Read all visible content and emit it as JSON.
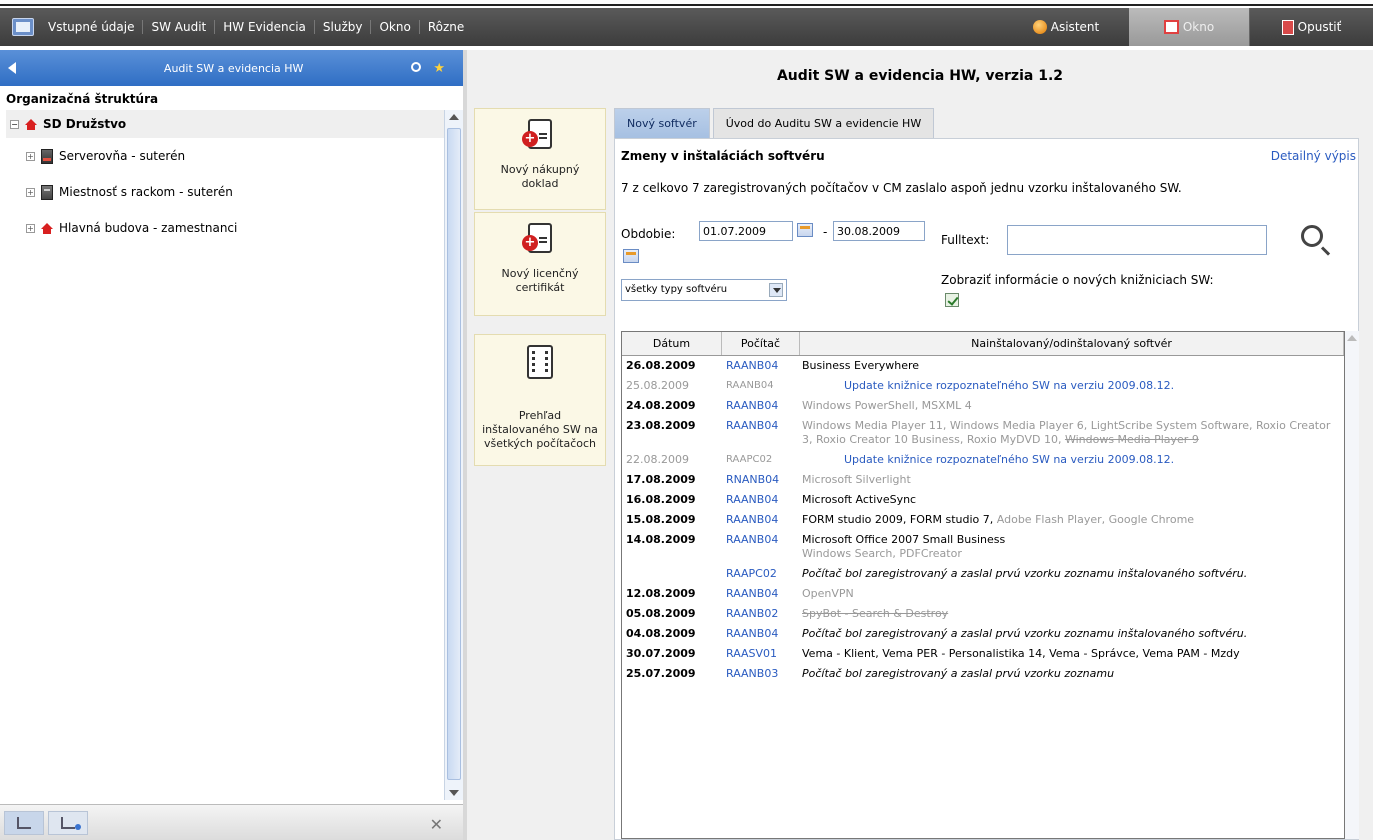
{
  "menubar": {
    "items": [
      "Vstupné údaje",
      "SW Audit",
      "HW Evidencia",
      "Služby",
      "Okno",
      "Rôzne"
    ],
    "asistent": "Asistent",
    "okno": "Okno",
    "opustit": "Opustiť"
  },
  "left": {
    "header": "Audit SW a evidencia HW",
    "org_title": "Organizačná štruktúra",
    "root": "SD Družstvo",
    "items": [
      "Serverovňa - suterén",
      "Miestnosť s rackom - suterén",
      "Hlavná budova - zamestnanci"
    ]
  },
  "main": {
    "app_title": "Audit SW a evidencia HW, verzia 1.2",
    "actions": [
      "Nový nákupný doklad",
      "Nový licenčný certifikát",
      "Prehľad inštalovaného SW na všetkých počítačoch"
    ],
    "tabs": [
      "Nový softvér",
      "Úvod do Auditu SW a evidencie HW"
    ],
    "panel_title": "Zmeny v inštaláciách softvéru",
    "detail_link": "Detailný výpis",
    "summary": "7 z celkovo 7 zaregistrovaných počítačov v CM zaslalo aspoň jednu vzorku inštalovaného SW.",
    "obdobie_label": "Obdobie:",
    "date_from": "01.07.2009",
    "date_to": "30.08.2009",
    "dash": "-",
    "fulltext_label": "Fulltext:",
    "fulltext_value": "",
    "type_select": "všetky typy softvéru",
    "lib_label": "Zobraziť informácie o nových knižniciach SW:",
    "lib_checked": true
  },
  "table": {
    "headers": [
      "Dátum",
      "Počítač",
      "Nainštalovaný/odinštalovaný softvér"
    ],
    "rows": [
      {
        "date": "26.08.2009",
        "pc": "RAANB04",
        "sw": "Business Everywhere"
      },
      {
        "date": "25.08.2009",
        "pc": "RAANB04",
        "sw": "Update knižnice rozpoznateľného SW na verziu 2009.08.12."
      },
      {
        "date": "24.08.2009",
        "pc": "RAANB04",
        "sw": "Windows PowerShell, MSXML 4"
      },
      {
        "date": "23.08.2009",
        "pc": "RAANB04",
        "sw": "Windows Media Player 11, Windows Media Player 6, LightScribe System Software, Roxio Creator 3, Roxio Creator 10 Business, Roxio MyDVD 10,",
        "sw_removed": "Windows Media Player 9"
      },
      {
        "date": "22.08.2009",
        "pc": "RAAPC02",
        "sw": "Update knižnice rozpoznateľného SW na verziu 2009.08.12."
      },
      {
        "date": "17.08.2009",
        "pc": "RNANB04",
        "sw": "Microsoft Silverlight"
      },
      {
        "date": "16.08.2009",
        "pc": "RAANB04",
        "sw": "Microsoft ActiveSync"
      },
      {
        "date": "15.08.2009",
        "pc": "RAANB04",
        "sw": "FORM studio 2009, FORM studio 7,",
        "sw_dim": "Adobe Flash Player, Google Chrome"
      },
      {
        "date": "14.08.2009",
        "pc": "RAANB04",
        "sw": "Microsoft Office 2007 Small Business",
        "sw_dim": "Windows Search, PDFCreator"
      },
      {
        "date": "",
        "pc": "RAAPC02",
        "sw": "Počítač bol zaregistrovaný a zaslal prvú vzorku zoznamu inštalovaného softvéru."
      },
      {
        "date": "12.08.2009",
        "pc": "RAANB04",
        "sw": "OpenVPN"
      },
      {
        "date": "05.08.2009",
        "pc": "RAANB02",
        "sw": "SpyBot - Search & Destroy"
      },
      {
        "date": "04.08.2009",
        "pc": "RAANB04",
        "sw": "Počítač bol zaregistrovaný a zaslal prvú vzorku zoznamu inštalovaného softvéru."
      },
      {
        "date": "30.07.2009",
        "pc": "RAASV01",
        "sw": "Vema - Klient, Vema PER - Personalistika 14, Vema - Správce, Vema PAM - Mzdy"
      },
      {
        "date": "25.07.2009",
        "pc": "RAANB03",
        "sw": "Počítač bol zaregistrovaný a zaslal prvú vzorku zoznamu"
      }
    ]
  }
}
